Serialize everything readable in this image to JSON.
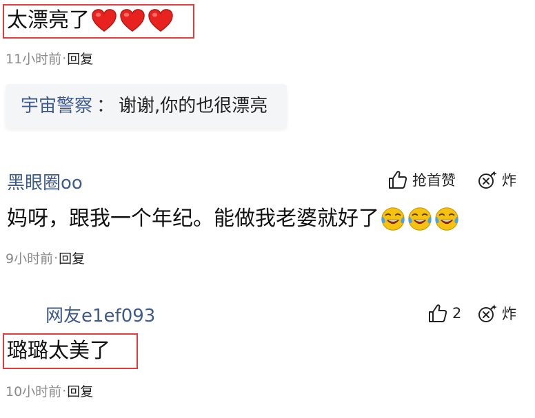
{
  "comment1": {
    "text": "太漂亮了",
    "emoji_icons": [
      "heart-icon",
      "heart-icon",
      "heart-icon"
    ],
    "time": "11小时前",
    "dot": "·",
    "reply_label": "回复",
    "reply": {
      "author": "宇宙警察",
      "separator": "：",
      "text": "谢谢,你的也很漂亮"
    }
  },
  "comment2": {
    "author": "黑眼圈oo",
    "like_label": "抢首赞",
    "blast_label": "炸",
    "text": "妈呀，跟我一个年纪。能做我老婆就好了",
    "emoji_icons": [
      "crying-laughing-icon",
      "crying-laughing-icon",
      "crying-laughing-icon"
    ],
    "time": "9小时前",
    "dot": "·",
    "reply_label": "回复"
  },
  "comment3": {
    "author": "网友e1ef093",
    "like_count": "2",
    "blast_label": "炸",
    "text": "璐璐太美了",
    "time": "10小时前",
    "dot": "·",
    "reply_label": "回复"
  },
  "colors": {
    "highlight_box": "#e23b3b",
    "username": "#3d5a8a",
    "meta_gray": "#8a8a8a",
    "heart_red": "#e8231f",
    "emoji_yellow": "#f5c20f"
  }
}
